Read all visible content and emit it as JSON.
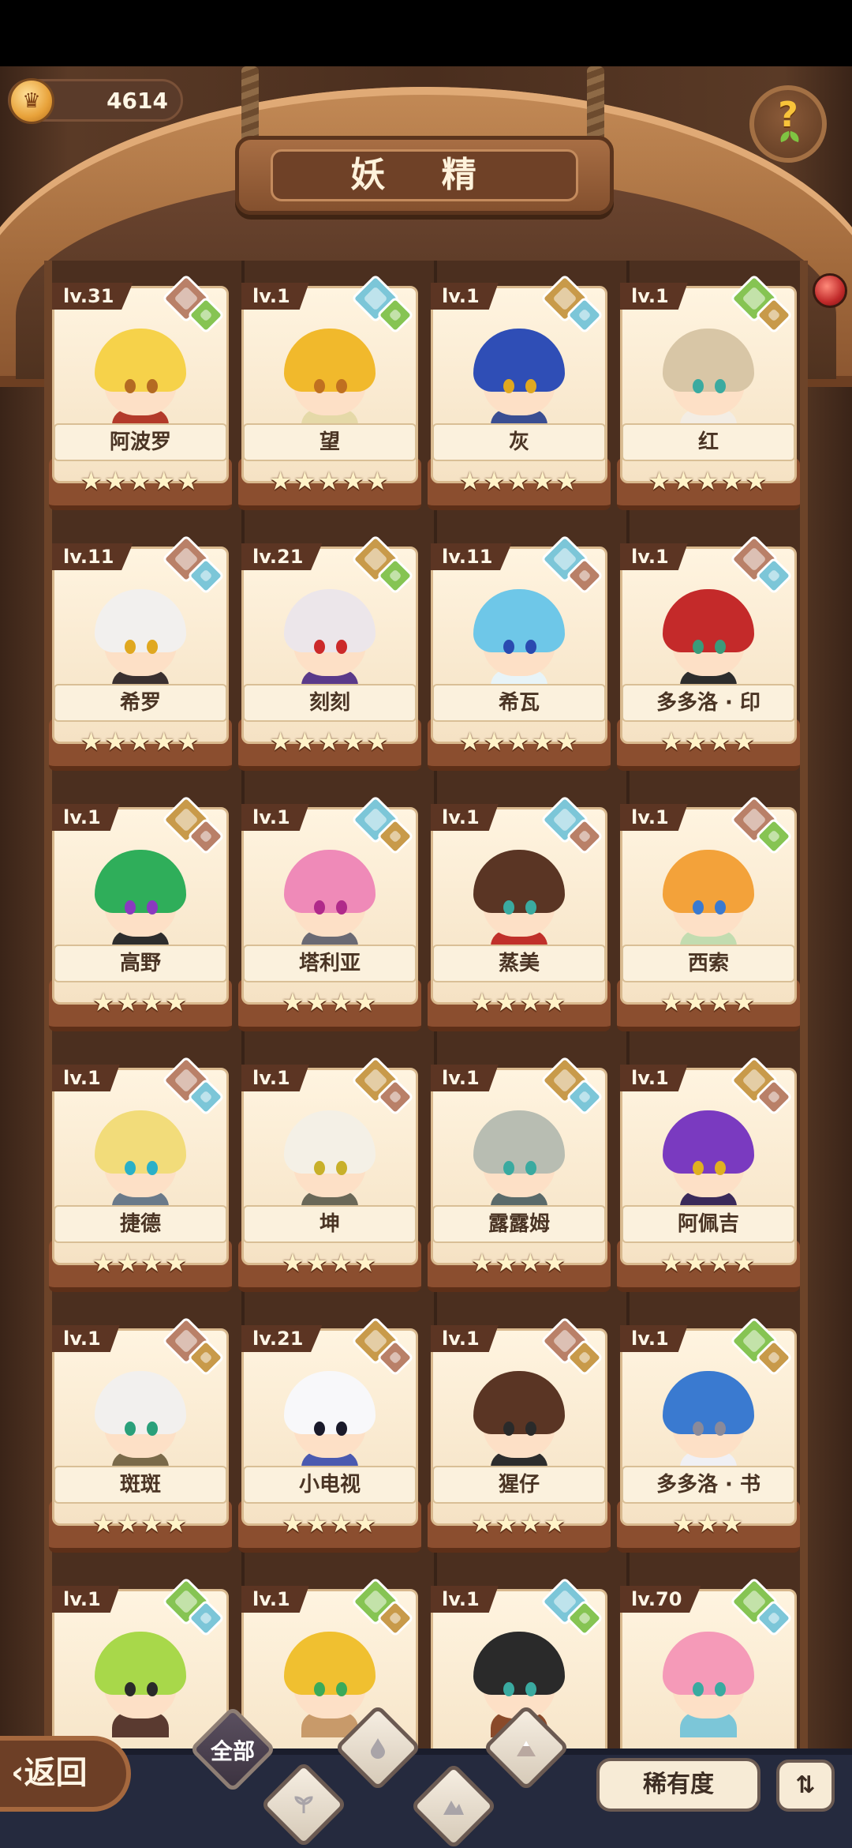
{
  "header": {
    "coins": "4614",
    "title": "妖 精",
    "help_icon": "question-sprout-icon"
  },
  "colors": {
    "element_earth": "#c89a4a",
    "element_water": "#7cc6d8",
    "element_nature": "#86c453",
    "element_mountain": "#b98068"
  },
  "cards": [
    {
      "level": "lv.31",
      "name": "阿波罗",
      "stars": "★★★★★",
      "hair": "#f6d24a",
      "outfit": "#b33a2a",
      "eyes": "#b46a22",
      "gems": [
        "#b98068",
        "#86c453"
      ]
    },
    {
      "level": "lv.1",
      "name": "望",
      "stars": "★★★★★",
      "hair": "#f1b92c",
      "outfit": "#e5d9a8",
      "eyes": "#c07020",
      "gems": [
        "#7cc6d8",
        "#86c453"
      ]
    },
    {
      "level": "lv.1",
      "name": "灰",
      "stars": "★★★★★",
      "hair": "#2f4eb6",
      "outfit": "#3a4e92",
      "eyes": "#e0a820",
      "gems": [
        "#c89a4a",
        "#7cc6d8"
      ]
    },
    {
      "level": "lv.1",
      "name": "红",
      "stars": "★★★★★",
      "hair": "#d8c6a6",
      "outfit": "#f3ede4",
      "eyes": "#3aaaa0",
      "gems": [
        "#86c453",
        "#c89a4a"
      ]
    },
    {
      "level": "lv.11",
      "name": "希罗",
      "stars": "★★★★★",
      "hair": "#f2f0ee",
      "outfit": "#3a3030",
      "eyes": "#e0a820",
      "gems": [
        "#b98068",
        "#7cc6d8"
      ]
    },
    {
      "level": "lv.21",
      "name": "刻刻",
      "stars": "★★★★★",
      "hair": "#ece6ea",
      "outfit": "#5a3a8a",
      "eyes": "#cc2a2a",
      "gems": [
        "#c89a4a",
        "#86c453"
      ]
    },
    {
      "level": "lv.11",
      "name": "希瓦",
      "stars": "★★★★★",
      "hair": "#6ec7e8",
      "outfit": "#e8f4f8",
      "eyes": "#2a4ab0",
      "gems": [
        "#7cc6d8",
        "#b98068"
      ]
    },
    {
      "level": "lv.1",
      "name": "多多洛 · 印",
      "stars": "★★★★",
      "hair": "#c42a2a",
      "outfit": "#2d2d2d",
      "eyes": "#3a9a7a",
      "gems": [
        "#b98068",
        "#7cc6d8"
      ]
    },
    {
      "level": "lv.1",
      "name": "高野",
      "stars": "★★★★",
      "hair": "#2fae5a",
      "outfit": "#2d2d2d",
      "eyes": "#8a3ac0",
      "gems": [
        "#c89a4a",
        "#b98068"
      ]
    },
    {
      "level": "lv.1",
      "name": "塔利亚",
      "stars": "★★★★",
      "hair": "#ef8ab8",
      "outfit": "#6a6a74",
      "eyes": "#b02a8a",
      "gems": [
        "#7cc6d8",
        "#c89a4a"
      ]
    },
    {
      "level": "lv.1",
      "name": "蒸美",
      "stars": "★★★★",
      "hair": "#5a3524",
      "outfit": "#c0302a",
      "eyes": "#3aaaa0",
      "gems": [
        "#7cc6d8",
        "#b98068"
      ]
    },
    {
      "level": "lv.1",
      "name": "西索",
      "stars": "★★★★",
      "hair": "#f3a23a",
      "outfit": "#c2dcb0",
      "eyes": "#3a7ad0",
      "gems": [
        "#b98068",
        "#86c453"
      ]
    },
    {
      "level": "lv.1",
      "name": "捷德",
      "stars": "★★★★",
      "hair": "#f2dc7a",
      "outfit": "#6a7a8a",
      "eyes": "#2ab0c8",
      "gems": [
        "#b98068",
        "#7cc6d8"
      ]
    },
    {
      "level": "lv.1",
      "name": "坤",
      "stars": "★★★★",
      "hair": "#f4f0e6",
      "outfit": "#6a6858",
      "eyes": "#c8b02a",
      "gems": [
        "#c89a4a",
        "#b98068"
      ]
    },
    {
      "level": "lv.1",
      "name": "露露姆",
      "stars": "★★★★",
      "hair": "#b8bdb2",
      "outfit": "#5a6a6a",
      "eyes": "#3aaaa0",
      "gems": [
        "#c89a4a",
        "#7cc6d8"
      ]
    },
    {
      "level": "lv.1",
      "name": "阿佩吉",
      "stars": "★★★★",
      "hair": "#7a3ac0",
      "outfit": "#3a2a5a",
      "eyes": "#e0b020",
      "gems": [
        "#c89a4a",
        "#b98068"
      ]
    },
    {
      "level": "lv.1",
      "name": "斑斑",
      "stars": "★★★★",
      "hair": "#f2f0ee",
      "outfit": "#7a6a4a",
      "eyes": "#2aa07a",
      "gems": [
        "#b98068",
        "#c89a4a"
      ]
    },
    {
      "level": "lv.21",
      "name": "小电视",
      "stars": "★★★★",
      "hair": "#f8f8fa",
      "outfit": "#4a5ab0",
      "eyes": "#1a1a2a",
      "gems": [
        "#c89a4a",
        "#b98068"
      ]
    },
    {
      "level": "lv.1",
      "name": "猩仔",
      "stars": "★★★★",
      "hair": "#5a3524",
      "outfit": "#2d2d2d",
      "eyes": "#2a2a2a",
      "gems": [
        "#b98068",
        "#c89a4a"
      ]
    },
    {
      "level": "lv.1",
      "name": "多多洛 · 书",
      "stars": "★★★",
      "hair": "#3a7ad0",
      "outfit": "#f0f0f4",
      "eyes": "#8a8a9a",
      "gems": [
        "#86c453",
        "#c89a4a"
      ]
    },
    {
      "level": "lv.1",
      "name": "",
      "stars": "",
      "hair": "#a8d84a",
      "outfit": "#5a3a30",
      "eyes": "#2a2a2a",
      "gems": [
        "#86c453",
        "#7cc6d8"
      ]
    },
    {
      "level": "lv.1",
      "name": "",
      "stars": "",
      "hair": "#f0c030",
      "outfit": "#c89a6a",
      "eyes": "#3aaa5a",
      "gems": [
        "#86c453",
        "#c89a4a"
      ]
    },
    {
      "level": "lv.1",
      "name": "",
      "stars": "",
      "hair": "#2a2a2a",
      "outfit": "#8a4a2a",
      "eyes": "#3aaaa0",
      "gems": [
        "#7cc6d8",
        "#86c453"
      ]
    },
    {
      "level": "lv.70",
      "name": "",
      "stars": "",
      "hair": "#f59ab8",
      "outfit": "#7cc6d8",
      "eyes": "#3aaaa0",
      "gems": [
        "#86c453",
        "#7cc6d8"
      ]
    }
  ],
  "bottom": {
    "back_label": "‹返回",
    "filter_all_label": "全部",
    "filters": [
      "water-drop-icon",
      "sprout-icon",
      "mountain-icon",
      "mountain-icon-2"
    ],
    "rarity_label": "稀有度",
    "sort_icon": "sort-icon",
    "sort_glyph": "⇅"
  }
}
